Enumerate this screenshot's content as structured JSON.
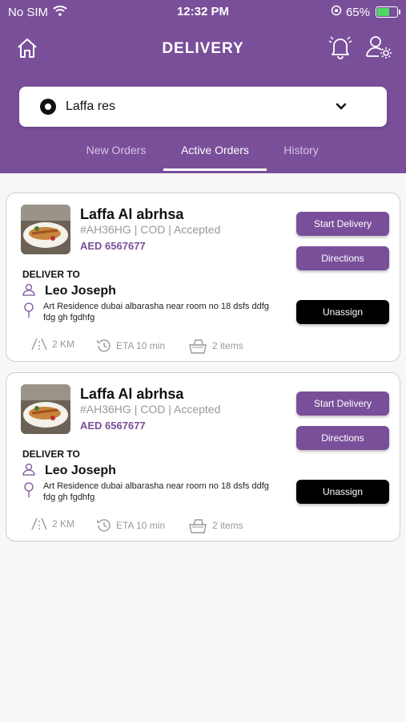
{
  "status_bar": {
    "carrier": "No SIM",
    "time": "12:32 PM",
    "battery": "65%",
    "battery_level": 0.65
  },
  "nav": {
    "title": "DELIVERY",
    "left_icon": "home-icon",
    "right_icons": [
      "bell-icon",
      "user-settings-icon"
    ]
  },
  "restaurant_select": {
    "value": "Laffa res"
  },
  "tabs": [
    {
      "label": "New Orders",
      "active": false
    },
    {
      "label": "Active Orders",
      "active": true
    },
    {
      "label": "History",
      "active": false
    }
  ],
  "orders": [
    {
      "restaurant": "Laffa Al abrhsa",
      "meta": "#AH36HG | COD | Accepted",
      "amount": "AED 6567677",
      "start_label": "Start Delivery",
      "directions_label": "Directions",
      "unassign_label": "Unassign",
      "deliver_to_label": "DELIVER TO",
      "customer": "Leo Joseph",
      "address": "Art Residence dubai albarasha near room no 18 dsfs ddfg fdg gh fgdhfg",
      "distance": "2 KM",
      "eta": "ETA 10 min",
      "items": "2 items"
    },
    {
      "restaurant": "Laffa Al abrhsa",
      "meta": "#AH36HG | COD | Accepted",
      "amount": "AED 6567677",
      "start_label": "Start Delivery",
      "directions_label": "Directions",
      "unassign_label": "Unassign",
      "deliver_to_label": "DELIVER TO",
      "customer": "Leo Joseph",
      "address": "Art Residence dubai albarasha near room no 18 dsfs ddfg fdg gh fgdhfg",
      "distance": "2 KM",
      "eta": "ETA 10 min",
      "items": "2 items"
    }
  ],
  "colors": {
    "primary": "#7a4f9a",
    "tab_inactive": "#d6c4e4",
    "background": "#f7f7f7",
    "unassign": "#000000"
  }
}
